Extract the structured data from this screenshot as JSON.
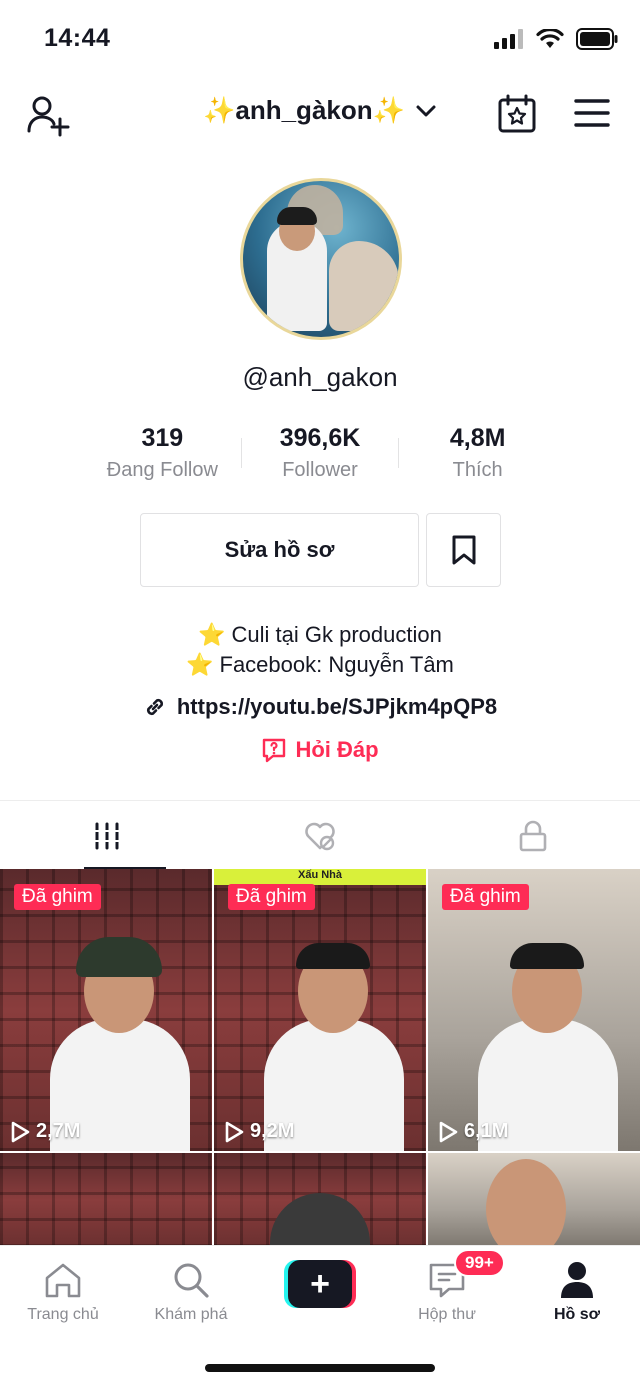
{
  "status_bar": {
    "time": "14:44"
  },
  "header": {
    "title": "✨anh_gàkon✨"
  },
  "profile": {
    "username": "@anh_gakon",
    "stats": [
      {
        "value": "319",
        "label": "Đang Follow"
      },
      {
        "value": "396,6K",
        "label": "Follower"
      },
      {
        "value": "4,8M",
        "label": "Thích"
      }
    ],
    "edit_label": "Sửa hồ sơ",
    "bio": [
      {
        "emoji": "⭐",
        "text": "Culi tại Gk production"
      },
      {
        "emoji": "⭐",
        "text": "Facebook: Nguyễn Tâm"
      }
    ],
    "link": "https://youtu.be/SJPjkm4pQP8",
    "qa_label": "Hỏi Đáp"
  },
  "videos": [
    {
      "pinned": "Đã ghim",
      "views": "2,7M"
    },
    {
      "pinned": "Đã ghim",
      "views": "9,2M",
      "banner": "Xấu Nhà"
    },
    {
      "pinned": "Đã ghim",
      "views": "6,1M"
    }
  ],
  "nav": {
    "home": "Trang chủ",
    "explore": "Khám phá",
    "inbox": "Hộp thư",
    "inbox_badge": "99+",
    "profile": "Hồ sơ"
  },
  "colors": {
    "accent": "#fe2c55",
    "cyan": "#25f4ee",
    "text": "#161823",
    "muted": "#8a8b91"
  }
}
